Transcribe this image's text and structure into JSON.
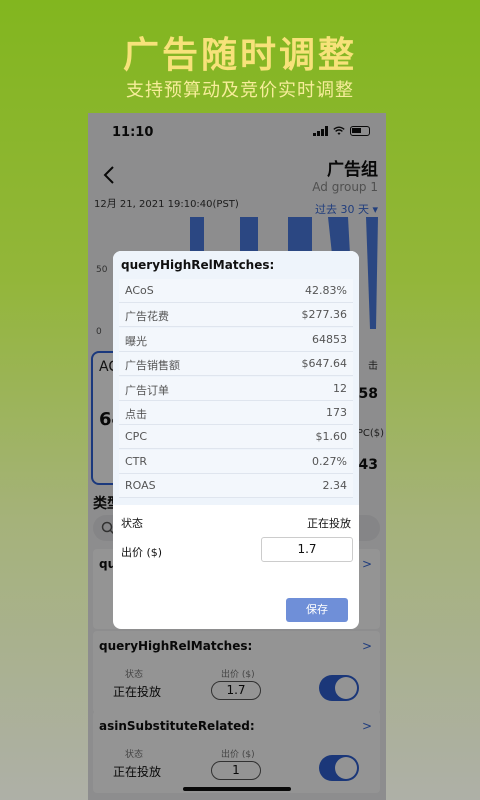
{
  "promo": {
    "title": "广告随时调整",
    "subtitle": "支持预算动及竞价实时调整"
  },
  "status_bar": {
    "time": "11:10"
  },
  "nav": {
    "title": "广告组",
    "subtitle": "Ad group 1",
    "date": "12月 21, 2021 19:10:40(PST)",
    "range": "过去 30 天 ▾"
  },
  "chart": {
    "ticks": [
      "50",
      "0"
    ]
  },
  "metrics": {
    "left_label": "AC",
    "left_value": "64",
    "right_a_label": "击",
    "right_a_value": "58",
    "right_b_label": "PC($)",
    "right_b_value": "43"
  },
  "list": {
    "type_label": "类型",
    "cards": [
      {
        "name": "qu",
        "state_label": "",
        "state": "",
        "bid_label": "",
        "bid": ""
      },
      {
        "name": "queryHighRelMatches:",
        "state_label": "状态",
        "state": "正在投放",
        "bid_label": "出价 ($)",
        "bid": "1.7"
      },
      {
        "name": "asinSubstituteRelated:",
        "state_label": "状态",
        "state": "正在投放",
        "bid_label": "出价 ($)",
        "bid": "1"
      }
    ]
  },
  "dialog": {
    "title": "queryHighRelMatches:",
    "rows": [
      {
        "k": "ACoS",
        "v": "42.83%"
      },
      {
        "k": "广告花费",
        "v": "$277.36"
      },
      {
        "k": "曝光",
        "v": "64853"
      },
      {
        "k": "广告销售额",
        "v": "$647.64"
      },
      {
        "k": "广告订单",
        "v": "12"
      },
      {
        "k": "点击",
        "v": "173"
      },
      {
        "k": "CPC",
        "v": "$1.60"
      },
      {
        "k": "CTR",
        "v": "0.27%"
      },
      {
        "k": "ROAS",
        "v": "2.34"
      }
    ],
    "status_label": "状态",
    "status_value": "正在投放",
    "bid_label": "出价 ($)",
    "bid_value": "1.7",
    "save_label": "保存"
  },
  "colors": {
    "accent": "#2f5fd0",
    "save_button": "#6f8fd8",
    "promo_text": "#f7e27a"
  }
}
